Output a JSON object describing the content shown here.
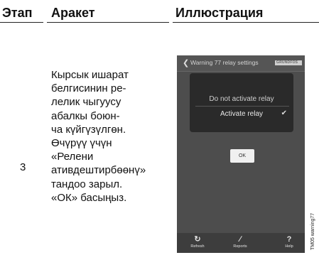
{
  "table": {
    "headers": [
      "Этап",
      "Аракет",
      "Иллюстрация"
    ],
    "step": "3",
    "action": "Кырсык ишарат\nбелгисинин ре-\nлелик чыгуусу\nабалкы боюн-\nча күйгүзүлгөн.\nӨчүрүү үчүн\n«Релени\nативдештирбөөнү»\nтандоо зарыл.\n«ОК» басыңыз."
  },
  "screen": {
    "title": "Warning 77 relay settings",
    "options": [
      "Do not activate relay",
      "Activate relay"
    ],
    "selected": "Activate relay",
    "ok_label": "OK",
    "bottom": [
      {
        "label": "Refresh",
        "icon": "refresh-icon"
      },
      {
        "label": "Reports",
        "icon": "pen-icon"
      },
      {
        "label": "Help",
        "icon": "help-icon"
      }
    ]
  },
  "figure_id": "TM05 warning77"
}
